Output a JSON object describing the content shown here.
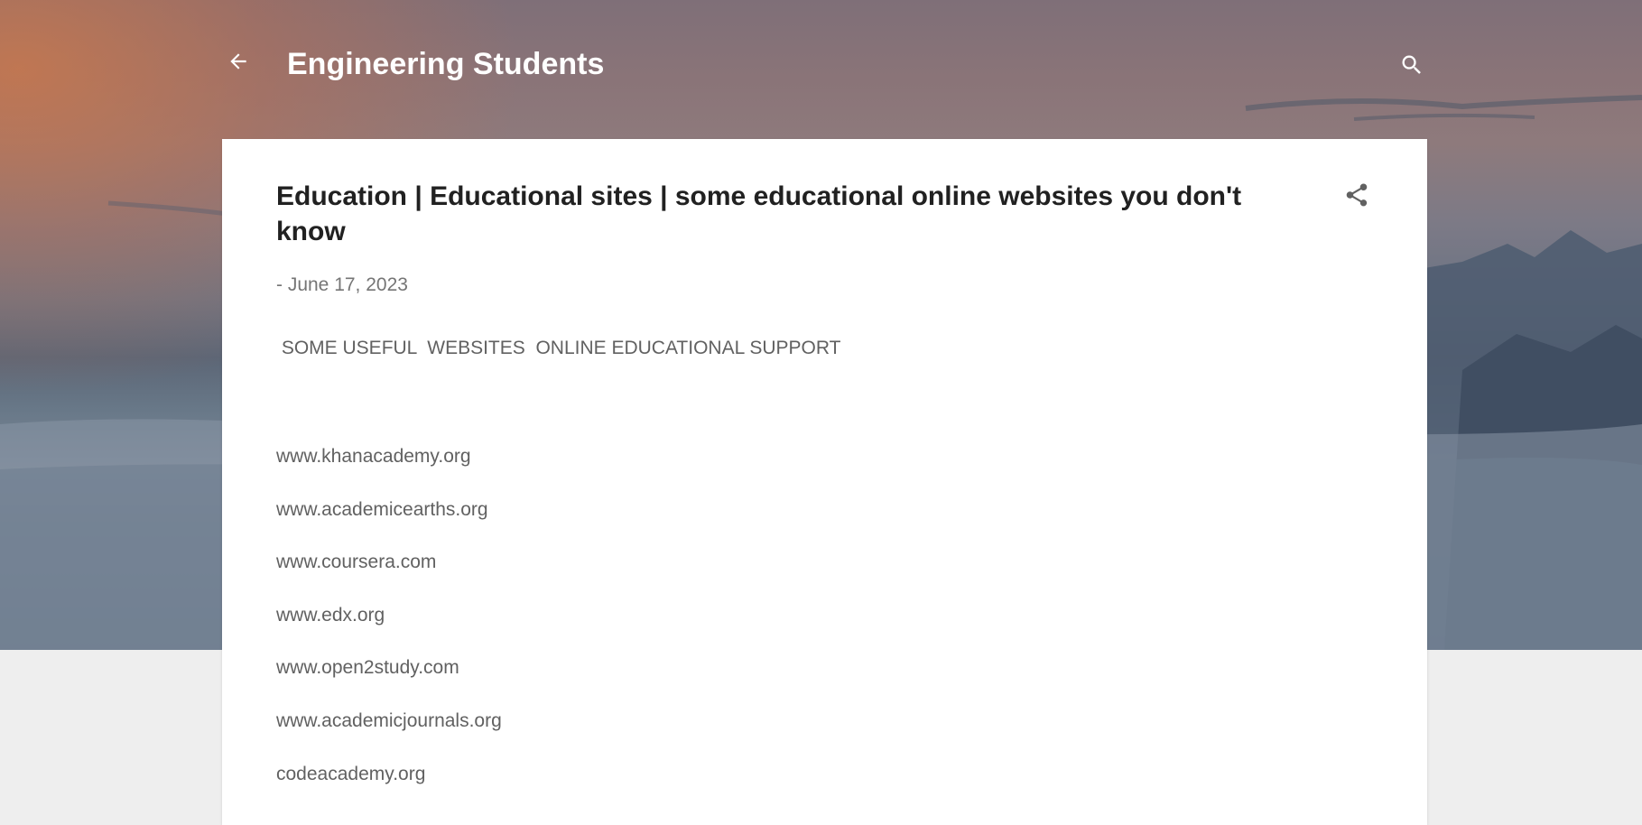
{
  "header": {
    "blog_title": "Engineering Students",
    "back_icon": "arrow-back-icon",
    "search_icon": "search-icon"
  },
  "post": {
    "title": "Education | Educational sites | some educational online websites you don't know",
    "date": "- June 17, 2023",
    "intro": " SOME USEFUL  WEBSITES  ONLINE EDUCATIONAL SUPPORT",
    "share_icon": "share-icon",
    "sites": [
      "www.khanacademy.org",
      "www.academicearths.org",
      "www.coursera.com",
      "www.edx.org",
      "www.open2study.com",
      "www.academicjournals.org",
      "codeacademy.org"
    ]
  },
  "colors": {
    "card_background": "#ffffff",
    "page_background": "#eeeeee",
    "title_text": "#212121",
    "body_text": "#616161",
    "header_text": "#ffffff"
  }
}
